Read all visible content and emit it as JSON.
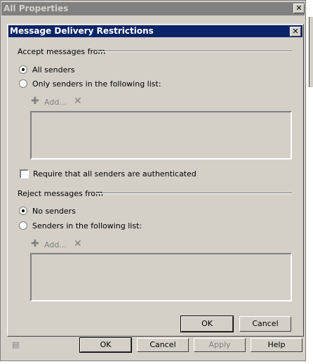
{
  "outer": {
    "title": "All Properties",
    "buttons": {
      "ok": "OK",
      "cancel": "Cancel",
      "apply": "Apply",
      "help": "Help"
    }
  },
  "dialog": {
    "title": "Message Delivery Restrictions",
    "accept": {
      "label": "Accept messages from",
      "all": "All senders",
      "only": "Only senders in the following list:",
      "add": "Add...",
      "selected": "all"
    },
    "require_auth": {
      "label": "Require that all senders are authenticated",
      "checked": false
    },
    "reject": {
      "label": "Reject messages from",
      "none": "No senders",
      "list": "Senders in the following list:",
      "add": "Add...",
      "selected": "none"
    },
    "ok": "OK",
    "cancel": "Cancel"
  }
}
